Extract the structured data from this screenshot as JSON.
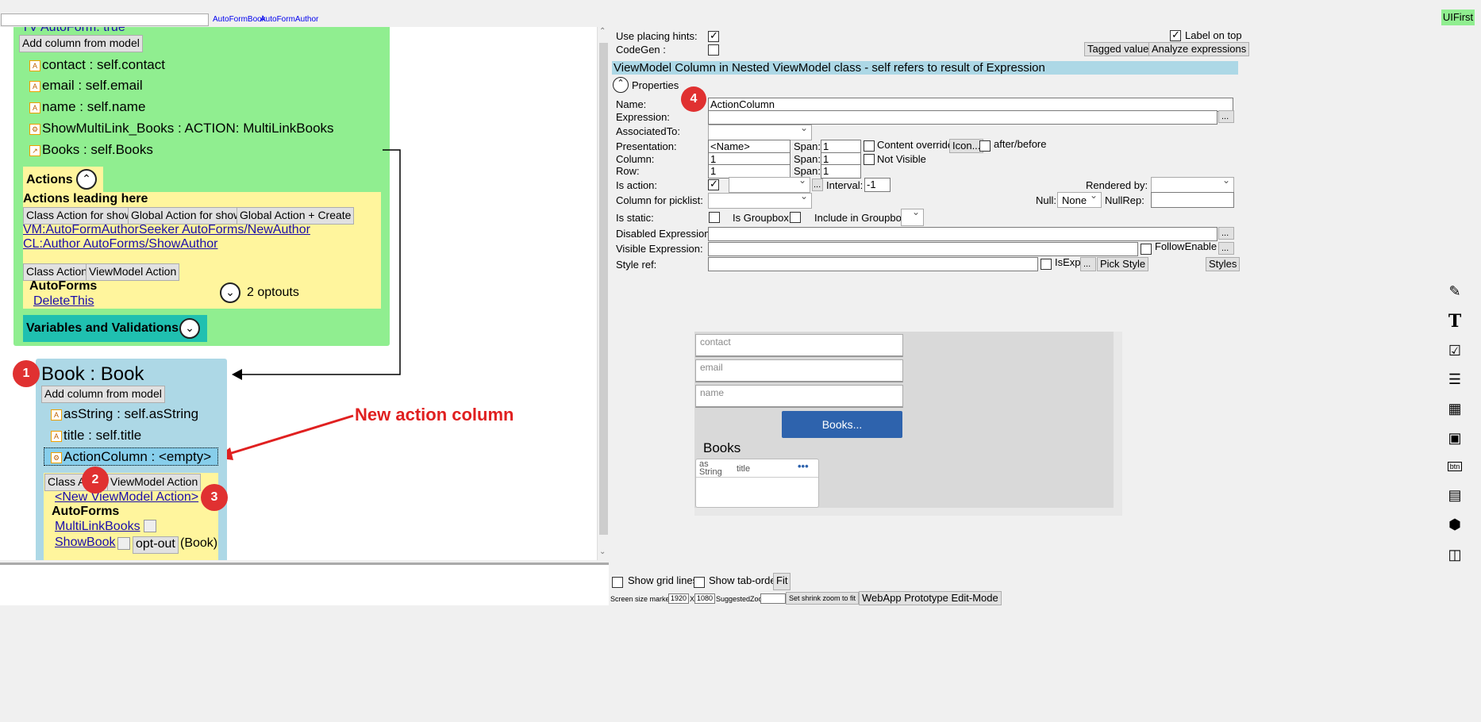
{
  "topbar": {
    "search_value": "",
    "link1": "AutoFormBook",
    "link2": "AutoFormAuthor",
    "uifirst": "UIFirst"
  },
  "author_panel": {
    "tv_autoform": "TV AutoForm: true",
    "add_column": "Add column from model",
    "columns": [
      "contact : self.contact",
      "email : self.email",
      "name : self.name",
      "ShowMultiLink_Books : ACTION: MultiLinkBooks",
      "Books : self.Books"
    ],
    "actions_header": "Actions",
    "actions_leading": "Actions leading here",
    "btn_class_action_show": "Class Action for show",
    "btn_global_action_show": "Global Action for show",
    "btn_global_create": "Global Action + Create",
    "link_vm": "VM:AutoFormAuthorSeeker AutoForms/NewAuthor",
    "link_cl": "CL:Author AutoForms/ShowAuthor",
    "btn_class_action": "Class Action",
    "btn_viewmodel_action": "ViewModel Action",
    "autoforms": "AutoForms",
    "delete_this": "DeleteThis",
    "optouts": "2 optouts",
    "variables": "Variables and Validations"
  },
  "book_panel": {
    "title": "Book : Book",
    "add_column": "Add column from model",
    "columns": [
      "asString : self.asString",
      "title : self.title",
      "ActionColumn : <empty>"
    ],
    "btn_class_action": "Class Action",
    "btn_viewmodel_action": "ViewModel Action",
    "new_vm_action": "<New ViewModel Action>",
    "autoforms": "AutoForms",
    "link_multilink": "MultiLinkBooks",
    "link_showbook": "ShowBook",
    "optout": "opt-out",
    "book_suffix": "(Book)"
  },
  "annotation": {
    "text": "New action column",
    "badges": [
      "1",
      "2",
      "3",
      "4"
    ]
  },
  "props": {
    "use_placing_hints": "Use placing hints:",
    "codegen": "CodeGen :",
    "label_on_top": "Label on top",
    "tagged_values": "Tagged values",
    "analyze": "Analyze expressions",
    "banner": "ViewModel Column in Nested ViewModel class - self refers to result of Expression",
    "properties": "Properties",
    "name_label": "Name:",
    "name_value": "ActionColumn",
    "expression_label": "Expression:",
    "associated_label": "AssociatedTo:",
    "presentation_label": "Presentation:",
    "presentation_value": "<Name>",
    "span_label": "Span:",
    "span1": "1",
    "span2": "1",
    "span3": "1",
    "content_override": "Content override",
    "icon_btn": "Icon...",
    "after_before": "after/before",
    "column_label": "Column:",
    "column_value": "1",
    "not_visible": "Not Visible",
    "row_label": "Row:",
    "row_value": "1",
    "is_action_label": "Is action:",
    "interval_label": "Interval:",
    "interval_value": "-1",
    "rendered_by": "Rendered by:",
    "picklist_label": "Column for picklist:",
    "null_label": "Null:",
    "null_value": "None",
    "nullrep_label": "NullRep:",
    "is_static": "Is static:",
    "is_groupbox": "Is Groupbox:",
    "include_groupbox": "Include in Groupbox:",
    "disabled_expr": "Disabled Expression",
    "visible_expr": "Visible Expression:",
    "follow_enable": "FollowEnable",
    "style_ref": "Style ref:",
    "isexp": "IsExp",
    "pick_style": "Pick Style",
    "styles": "Styles",
    "dots": "..."
  },
  "preview": {
    "fields": [
      "contact",
      "email",
      "name"
    ],
    "books_btn": "Books...",
    "books_title": "Books",
    "col1": "as String",
    "col2": "title",
    "more": "•••"
  },
  "bottom": {
    "show_grid": "Show grid lines",
    "show_tab": "Show tab-order",
    "fit": "Fit",
    "screen_size": "Screen size marker",
    "w": "1920",
    "x": "X",
    "h": "1080",
    "suggested": "SuggestedZoom",
    "shrink_btn": "Set shrink zoom to fit",
    "prototype_btn": "WebApp Prototype Edit-Mode"
  },
  "side_icons": [
    "edit-icon",
    "text-icon",
    "checkbox-icon",
    "combo-icon",
    "calendar-icon",
    "image-icon",
    "button-icon",
    "list-icon",
    "cube-icon",
    "iframe-icon"
  ]
}
